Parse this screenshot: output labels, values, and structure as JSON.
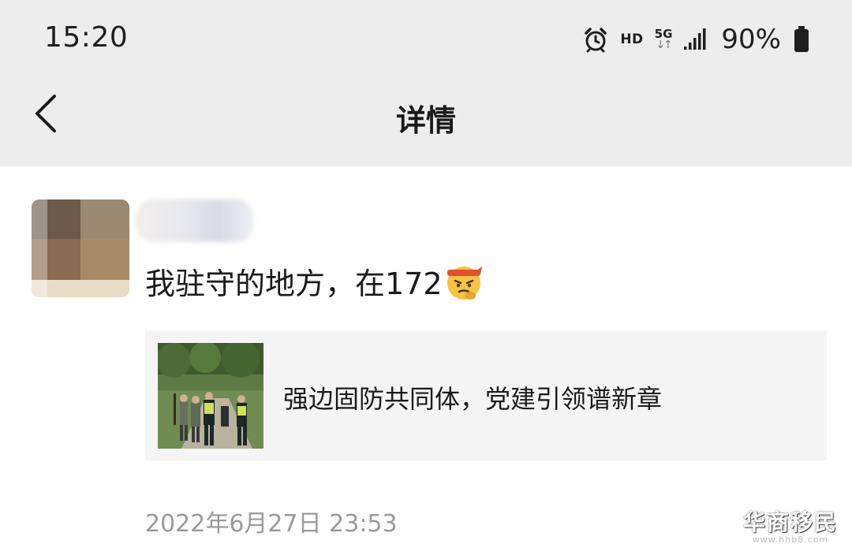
{
  "status_bar": {
    "time": "15:20",
    "hd": "HD",
    "network": "5G",
    "battery": "90%",
    "icons": [
      "alarm-icon",
      "signal-icon",
      "battery-icon"
    ]
  },
  "nav": {
    "title": "详情",
    "back_icon": "chevron-left-icon"
  },
  "post": {
    "author_name": "",
    "text": "我驻守的地方，在172",
    "emoji": "determined-face-emoji",
    "link_card": {
      "title": "强边固防共同体，党建引领谱新章",
      "thumbnail": "soldiers-patrol-photo"
    },
    "timestamp": "2022年6月27日 23:53"
  },
  "watermark": {
    "logo": "华商移民",
    "url": "www.hhb8.com"
  },
  "colors": {
    "header_bg": "#ededed",
    "card_bg": "#f5f5f5",
    "timestamp": "#9a9a9a"
  }
}
